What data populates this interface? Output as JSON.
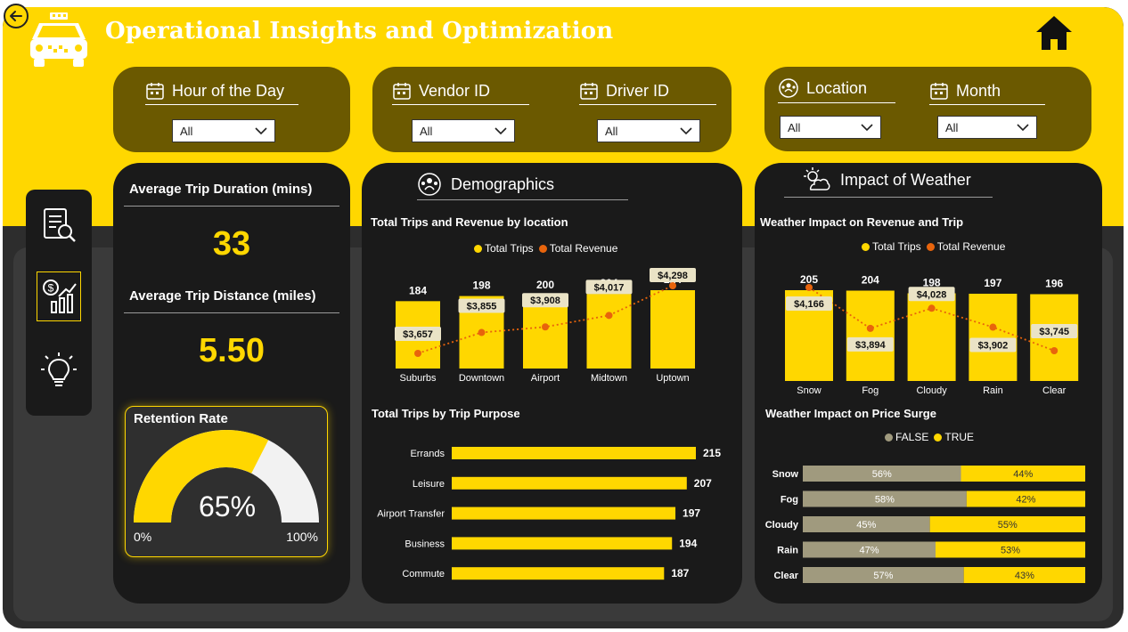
{
  "header": {
    "title": "Operational Insights and Optimization"
  },
  "filters": {
    "hour": {
      "label": "Hour of the Day",
      "value": "All"
    },
    "vendor": {
      "label": "Vendor ID",
      "value": "All"
    },
    "driver": {
      "label": "Driver ID",
      "value": "All"
    },
    "location": {
      "label": "Location",
      "value": "All"
    },
    "month": {
      "label": "Month",
      "value": "All"
    }
  },
  "nav": {
    "items": [
      "report-icon",
      "finance-chart-icon",
      "lightbulb-icon"
    ],
    "active_index": 1
  },
  "kpis": {
    "duration_label": "Average Trip Duration (mins)",
    "duration_value": "33",
    "distance_label": "Average Trip Distance (miles)",
    "distance_value": "5.50"
  },
  "retention": {
    "label": "Retention Rate",
    "value_text": "65%",
    "min_label": "0%",
    "max_label": "100%"
  },
  "demographics": {
    "title": "Demographics"
  },
  "weather": {
    "title": "Impact of Weather"
  },
  "colors": {
    "accent": "#ffd700",
    "revenue": "#e8640c",
    "false_series": "#a09a7e",
    "card_bg": "#1a1a1a"
  },
  "chart_data": [
    {
      "id": "trips_revenue_location",
      "type": "bar",
      "title": "Total Trips and Revenue by location",
      "categories": [
        "Suburbs",
        "Downtown",
        "Airport",
        "Midtown",
        "Uptown"
      ],
      "series": [
        {
          "name": "Total Trips",
          "values": [
            184,
            198,
            200,
            204,
            214
          ],
          "labels": [
            "184",
            "198",
            "200",
            "204",
            "214"
          ]
        },
        {
          "name": "Total Revenue",
          "values": [
            3657,
            3855,
            3908,
            4017,
            4298
          ],
          "labels": [
            "$3,657",
            "$3,855",
            "$3,908",
            "$4,017",
            "$4,298"
          ]
        }
      ],
      "legend": "top-center"
    },
    {
      "id": "trips_by_purpose",
      "type": "bar",
      "orientation": "horizontal",
      "title": "Total Trips by Trip Purpose",
      "categories": [
        "Errands",
        "Leisure",
        "Airport Transfer",
        "Business",
        "Commute"
      ],
      "values": [
        215,
        207,
        197,
        194,
        187
      ],
      "labels": [
        "215",
        "207",
        "197",
        "194",
        "187"
      ]
    },
    {
      "id": "weather_revenue_trip",
      "type": "bar",
      "title": "Weather Impact on Revenue and Trip",
      "categories": [
        "Snow",
        "Fog",
        "Cloudy",
        "Rain",
        "Clear"
      ],
      "series": [
        {
          "name": "Total Trips",
          "values": [
            205,
            204,
            198,
            197,
            196
          ],
          "labels": [
            "205",
            "204",
            "198",
            "197",
            "196"
          ]
        },
        {
          "name": "Total Revenue",
          "values": [
            4166,
            3894,
            4028,
            3902,
            3745
          ],
          "labels": [
            "$4,166",
            "$3,894",
            "$4,028",
            "$3,902",
            "$3,745"
          ]
        }
      ],
      "legend": "top-center"
    },
    {
      "id": "weather_price_surge",
      "type": "bar",
      "orientation": "horizontal",
      "stacked": "100%",
      "title": "Weather Impact on Price Surge",
      "categories": [
        "Snow",
        "Fog",
        "Cloudy",
        "Rain",
        "Clear"
      ],
      "series": [
        {
          "name": "FALSE",
          "values": [
            56,
            58,
            45,
            47,
            57
          ],
          "labels": [
            "56%",
            "58%",
            "45%",
            "47%",
            "57%"
          ]
        },
        {
          "name": "TRUE",
          "values": [
            44,
            42,
            55,
            53,
            43
          ],
          "labels": [
            "44%",
            "42%",
            "55%",
            "53%",
            "43%"
          ]
        }
      ],
      "legend": "top-left"
    },
    {
      "id": "retention_gauge",
      "type": "gauge",
      "value": 65,
      "min": 0,
      "max": 100
    }
  ]
}
